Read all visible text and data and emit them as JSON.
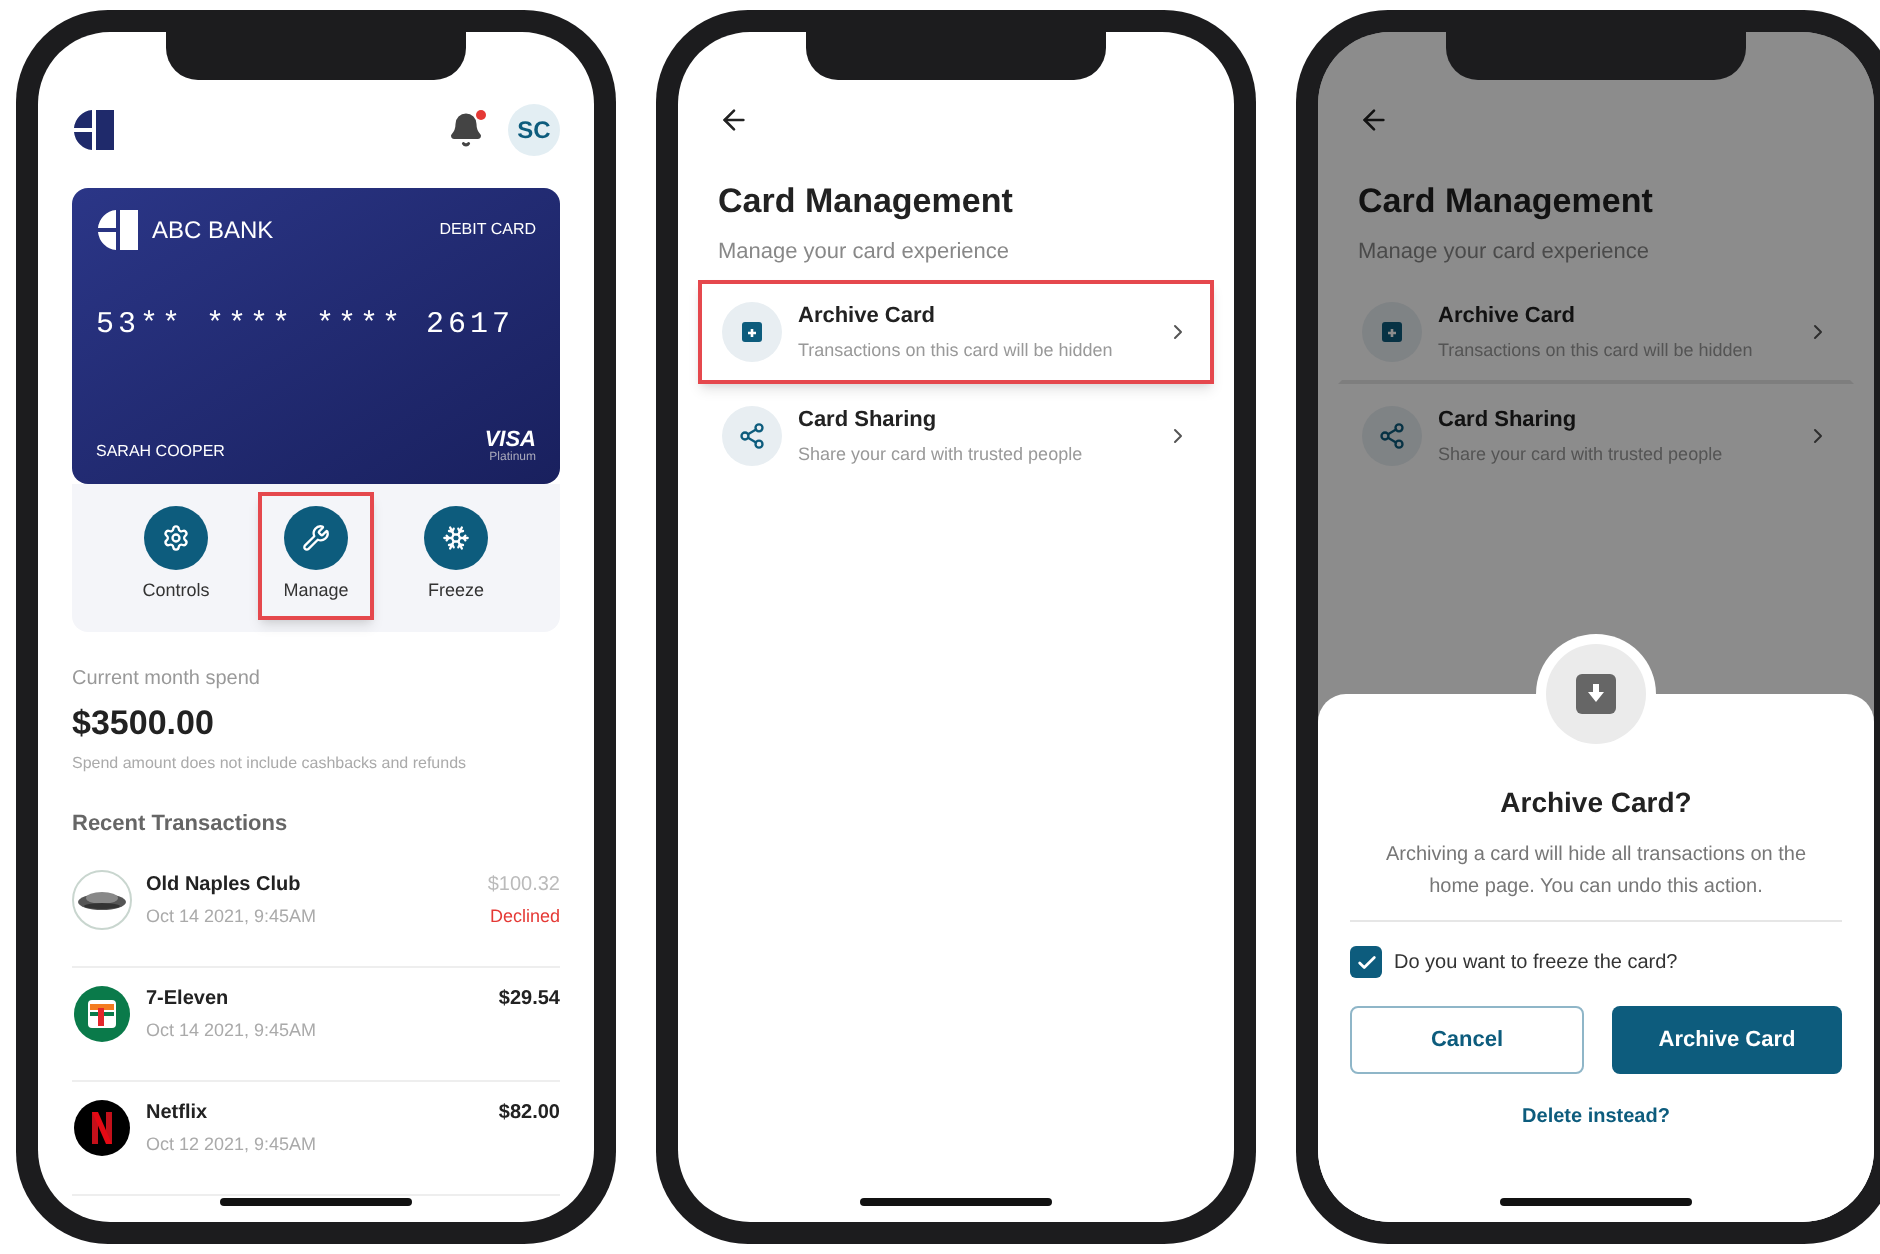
{
  "screens": [
    {
      "kind": "home",
      "avatar": "SC",
      "unread": true,
      "card": {
        "bank": "ABC BANK",
        "type": "DEBIT CARD",
        "number": "53** **** **** 2617",
        "holder": "SARAH COOPER",
        "network": "VISA",
        "tier": "Platinum"
      },
      "actions": [
        {
          "kind": "controls",
          "label": "Controls",
          "highlighted": false
        },
        {
          "kind": "manage",
          "label": "Manage",
          "highlighted": true
        },
        {
          "kind": "freeze",
          "label": "Freeze",
          "highlighted": false
        }
      ],
      "spend": {
        "label": "Current month spend",
        "amount": "$3500.00",
        "note": "Spend amount does not include cashbacks and refunds"
      },
      "section_title": "Recent Transactions",
      "transactions": [
        {
          "kind": "club",
          "name": "Old Naples Club",
          "date": "Oct 14 2021, 9:45AM",
          "amount": "$100.32",
          "declined": true,
          "status": "Declined"
        },
        {
          "kind": "store",
          "name": "7-Eleven",
          "date": "Oct 14 2021, 9:45AM",
          "amount": "$29.54",
          "declined": false
        },
        {
          "kind": "streaming",
          "name": "Netflix",
          "date": "Oct 12 2021, 9:45AM",
          "amount": "$82.00",
          "declined": false
        }
      ]
    },
    {
      "kind": "manage",
      "title": "Card Management",
      "subtitle": "Manage your card experience",
      "dimmed": false,
      "options": [
        {
          "kind": "archive",
          "title": "Archive Card",
          "subtitle": "Transactions on this card will be hidden",
          "highlighted": true
        },
        {
          "kind": "share",
          "title": "Card Sharing",
          "subtitle": "Share your card with trusted people",
          "highlighted": false
        }
      ]
    },
    {
      "kind": "manage",
      "title": "Card Management",
      "subtitle": "Manage your card experience",
      "dimmed": true,
      "options": [
        {
          "kind": "archive",
          "title": "Archive Card",
          "subtitle": "Transactions on this card will be hidden",
          "highlighted": false
        },
        {
          "kind": "share",
          "title": "Card Sharing",
          "subtitle": "Share your card with trusted people",
          "highlighted": false
        }
      ],
      "dialog": {
        "title": "Archive Card?",
        "body": "Archiving a card will hide all transactions on the home page. You can undo this action.",
        "checkbox": {
          "label": "Do you want to freeze the card?",
          "checked": true
        },
        "cancel": "Cancel",
        "confirm": "Archive Card",
        "link": "Delete instead?"
      }
    }
  ]
}
